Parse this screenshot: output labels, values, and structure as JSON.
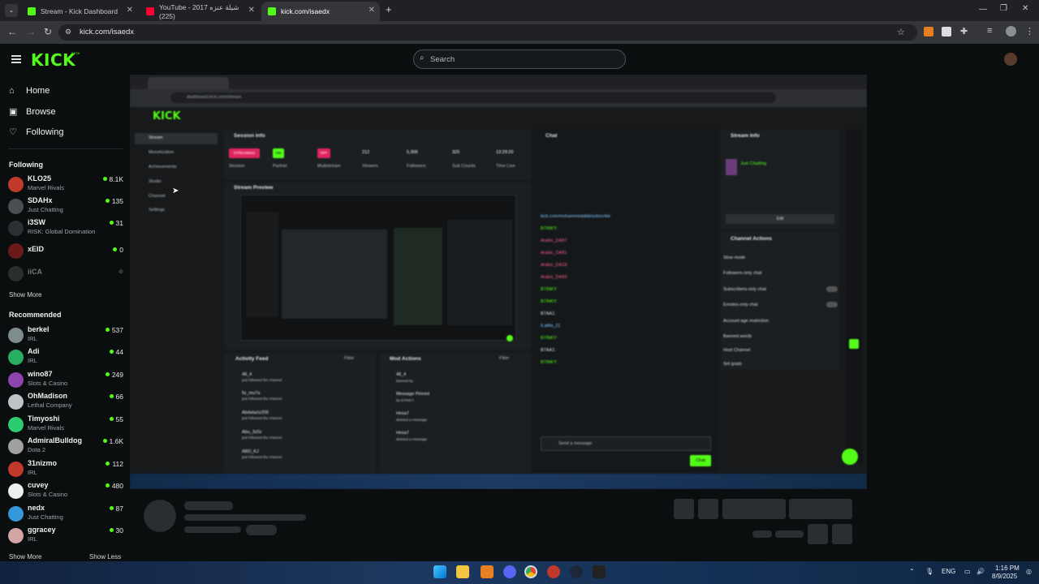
{
  "browser": {
    "tabs": [
      {
        "title": "Stream - Kick Dashboard",
        "active": false
      },
      {
        "title": "YouTube - 2017 شيلة عنزه (225)",
        "active": false
      },
      {
        "title": "kick.com/isaedx",
        "active": true
      }
    ],
    "url": "kick.com/isaedx",
    "new_tab": "+"
  },
  "header": {
    "logo": "KICK",
    "logo_badge": "BETA",
    "search_placeholder": "Search"
  },
  "sidebar": {
    "nav": [
      {
        "label": "Home",
        "icon": "home-icon"
      },
      {
        "label": "Browse",
        "icon": "browse-icon"
      },
      {
        "label": "Following",
        "icon": "heart-icon"
      }
    ],
    "following_title": "Following",
    "following": [
      {
        "name": "KLO25",
        "category": "Marvel Rivals",
        "viewers": "8.1K",
        "color": "#c0392b"
      },
      {
        "name": "SDAHx",
        "category": "Just Chatting",
        "viewers": "135",
        "color": "#4a4f55"
      },
      {
        "name": "i3SW",
        "category": "RISK: Global Domination",
        "viewers": "31",
        "color": "#2c2f33"
      },
      {
        "name": "xEID",
        "category": "",
        "viewers": "0",
        "color": "#6b1a1a"
      },
      {
        "name": "iiCA",
        "category": "",
        "viewers": "",
        "color": "#555"
      }
    ],
    "show_more_following": "Show More",
    "recommended_title": "Recommended",
    "recommended": [
      {
        "name": "berkel",
        "category": "IRL",
        "viewers": "537",
        "color": "#7f8c8d"
      },
      {
        "name": "Adi",
        "category": "IRL",
        "viewers": "44",
        "color": "#27ae60"
      },
      {
        "name": "wino87",
        "category": "Slots & Casino",
        "viewers": "249",
        "color": "#8e44ad"
      },
      {
        "name": "OhMadison",
        "category": "Lethal Company",
        "viewers": "66",
        "color": "#bdc3c7"
      },
      {
        "name": "Timyoshi",
        "category": "Marvel Rivals",
        "viewers": "55",
        "color": "#2ecc71"
      },
      {
        "name": "AdmiralBulldog",
        "category": "Dota 2",
        "viewers": "1.6K",
        "color": "#a0a0a0"
      },
      {
        "name": "31nizmo",
        "category": "IRL",
        "viewers": "112",
        "color": "#c0392b"
      },
      {
        "name": "cuvey",
        "category": "Slots & Casino",
        "viewers": "480",
        "color": "#ecf0f1"
      },
      {
        "name": "nedx",
        "category": "Just Chatting",
        "viewers": "87",
        "color": "#3498db"
      },
      {
        "name": "ggracey",
        "category": "IRL",
        "viewers": "30",
        "color": "#d4a5a5"
      }
    ],
    "show_more": "Show More",
    "show_less": "Show Less"
  },
  "stream": {
    "inner_logo": "KICK",
    "inner_url": "dashboard.kick.com/stream",
    "menu": [
      "Stream",
      "Monetization",
      "Achievements",
      "Studio",
      "Channel",
      "Settings"
    ],
    "session_title": "Session info",
    "stats": [
      {
        "value": "STREAMING",
        "label": "Session"
      },
      {
        "value": "ON",
        "label": "Partner"
      },
      {
        "value": "OFF",
        "label": "Multistream"
      },
      {
        "value": "212",
        "label": "Viewers"
      },
      {
        "value": "5,306",
        "label": "Followers"
      },
      {
        "value": "325",
        "label": "Sub Counts"
      },
      {
        "value": "13:29:20",
        "label": "Time Live"
      }
    ],
    "preview_title": "Stream Preview",
    "activity_title": "Activity Feed",
    "mod_title": "Mod Actions",
    "filter_label": "Filter",
    "activity": [
      {
        "user": "48_4",
        "note": "just followed the channel"
      },
      {
        "user": "fiz_mo7a",
        "note": "just followed the channel"
      },
      {
        "user": "Abdalaziz205",
        "note": "just followed the channel"
      },
      {
        "user": "Abu_3z0z",
        "note": "just followed the channel"
      },
      {
        "user": "ABD_KJ",
        "note": "just followed the channel"
      }
    ],
    "mod": [
      {
        "user": "48_4",
        "note": "banned by"
      },
      {
        "user": "Message Pinned",
        "note": "by B7INKY"
      },
      {
        "user": "Hesa7",
        "note": "deleted a message"
      },
      {
        "user": "Hesa7",
        "note": "deleted a message"
      }
    ],
    "chat_title": "Chat",
    "chat_lines": [
      "kick.com/mohammedabb/subscribe",
      "B7INKY:",
      "Arabic_DA97",
      "Arabic_DA81",
      "Arabic_DA18",
      "Arabic_DA93",
      "B7INKY:",
      "B7INKY:",
      "B7AA1:",
      "ILaMa_21",
      "B7INKY:",
      "B7AA1:",
      "B7INKY:"
    ],
    "chat_placeholder": "Send a message",
    "chat_button": "Chat",
    "stream_info_title": "Stream Info",
    "stream_info_category": "Just Chatting",
    "edit_label": "Edit",
    "channel_actions_title": "Channel Actions",
    "channel_actions": [
      "Slow mode",
      "Followers-only chat",
      "Subscribers-only chat",
      "Emotes-only chat",
      "Account age restriction",
      "Banned words",
      "Host Channel",
      "Set goals"
    ]
  },
  "taskbar": {
    "lang": "ENG",
    "time": "1:16 PM",
    "date": "8/9/2025"
  },
  "colors": {
    "brand": "#53fc18",
    "bg": "#0b0e0f"
  }
}
